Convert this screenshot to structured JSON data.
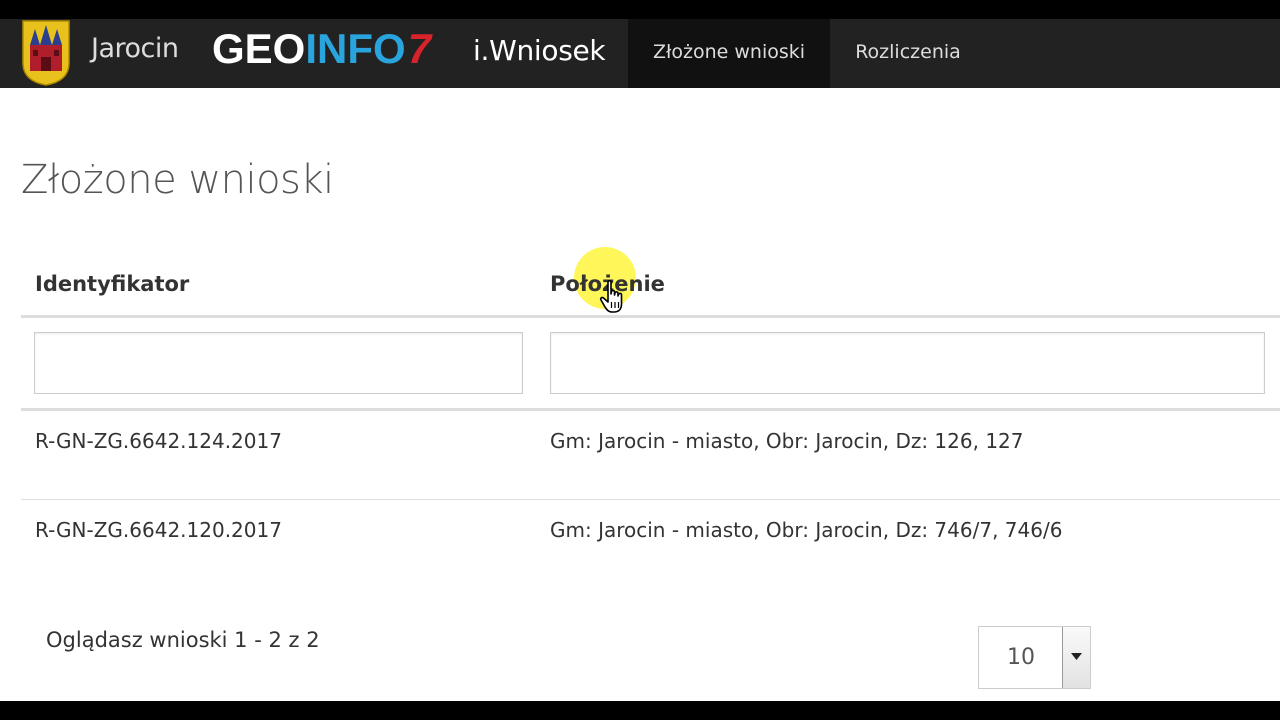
{
  "header": {
    "town": "Jarocin",
    "logo_geo": "GEO",
    "logo_info": "INFO",
    "logo_seven": "7",
    "app_name": "i.Wniosek",
    "nav": [
      {
        "label": "Złożone wnioski",
        "active": true
      },
      {
        "label": "Rozliczenia",
        "active": false
      }
    ],
    "brand_colors": {
      "navbar_bg": "#222222",
      "info_blue": "#2aa4dc",
      "seven_red": "#d8232a"
    }
  },
  "page": {
    "title": "Złożone wnioski"
  },
  "table": {
    "columns": [
      "Identyfikator",
      "Położenie"
    ],
    "filters": {
      "identyfikator": "",
      "polozenie": ""
    },
    "rows": [
      {
        "identyfikator": "R-GN-ZG.6642.124.2017",
        "polozenie": "Gm: Jarocin - miasto, Obr: Jarocin, Dz: 126, 127"
      },
      {
        "identyfikator": "R-GN-ZG.6642.120.2017",
        "polozenie": "Gm: Jarocin - miasto, Obr: Jarocin, Dz: 746/7, 746/6"
      }
    ]
  },
  "pager": {
    "info": "Oglądasz wnioski 1 - 2 z 2",
    "page_size": "10"
  },
  "icons": {
    "crest": "coat-of-arms-icon",
    "dropdown": "caret-down-icon",
    "cursor": "hand-pointer-icon"
  }
}
